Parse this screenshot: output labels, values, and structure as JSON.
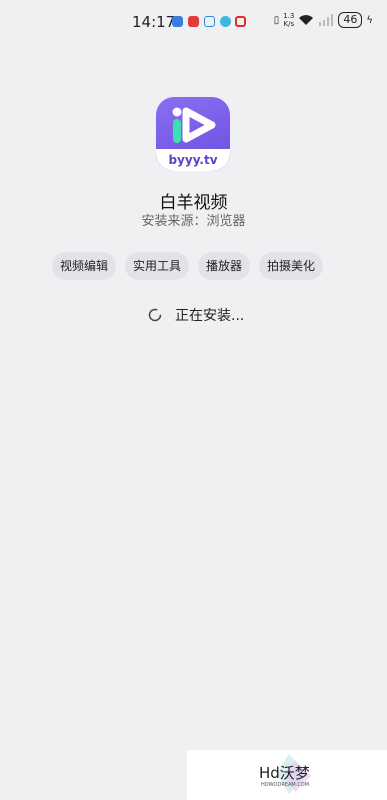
{
  "status_bar": {
    "time": "14:17",
    "net_speed_top": "1.3",
    "net_speed_bottom": "K/s",
    "battery": "46",
    "notif_colors": [
      "#3b7ddd",
      "#e23b3b",
      "#2a8cd8",
      "#3bb8e0",
      "#e02b2b"
    ]
  },
  "app": {
    "icon_text": "byyy.tv",
    "name": "白羊视频",
    "source_label": "安装来源：",
    "source_value": "浏览器",
    "brand_color": "#6a4fe0"
  },
  "tags": [
    "视频编辑",
    "实用工具",
    "播放器",
    "拍摄美化"
  ],
  "progress": {
    "text": "正在安装..."
  },
  "watermark": {
    "text": "Hd沃梦",
    "sub": "HDWODREAM.COM"
  }
}
